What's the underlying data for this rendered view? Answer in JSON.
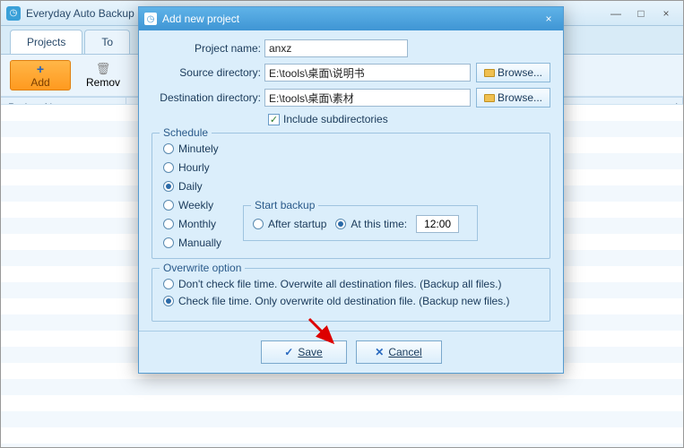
{
  "app": {
    "title": "Everyday Auto Backup"
  },
  "tabs": {
    "projects": "Projects",
    "tools": "To"
  },
  "toolbar": {
    "add": "Add",
    "remove": "Remov"
  },
  "table": {
    "col_name": "Project Name",
    "col_last": "I"
  },
  "dialog": {
    "title": "Add new project",
    "labels": {
      "project_name": "Project name:",
      "source_dir": "Source directory:",
      "dest_dir": "Destination directory:",
      "include_sub": "Include subdirectories",
      "browse": "Browse..."
    },
    "values": {
      "project_name": "anxz",
      "source_dir": "E:\\tools\\桌面\\说明书",
      "dest_dir": "E:\\tools\\桌面\\素材",
      "time": "12:00"
    },
    "schedule": {
      "legend": "Schedule",
      "minutely": "Minutely",
      "hourly": "Hourly",
      "daily": "Daily",
      "weekly": "Weekly",
      "monthly": "Monthly",
      "manually": "Manually",
      "start_legend": "Start backup",
      "after_startup": "After startup",
      "at_this_time": "At this time:"
    },
    "overwrite": {
      "legend": "Overwrite option",
      "opt1": "Don't check file time. Overwite all destination files. (Backup all files.)",
      "opt2": "Check file time. Only overwrite old destination file. (Backup new files.)"
    },
    "buttons": {
      "save": "Save",
      "cancel": "Cancel"
    }
  }
}
